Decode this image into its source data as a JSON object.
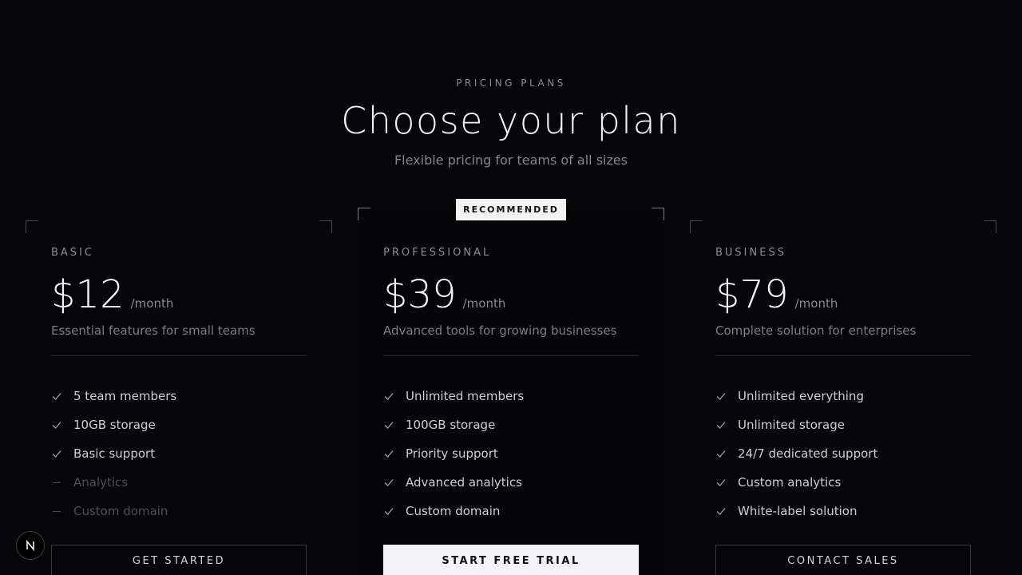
{
  "header": {
    "eyebrow": "PRICING PLANS",
    "title": "Choose your plan",
    "subtitle": "Flexible pricing for teams of all sizes"
  },
  "badge": {
    "label": "RECOMMENDED"
  },
  "plans": [
    {
      "name": "BASIC",
      "price": "$12",
      "period": "/month",
      "description": "Essential features for small teams",
      "features": [
        {
          "label": "5 team members",
          "included": true
        },
        {
          "label": "10GB storage",
          "included": true
        },
        {
          "label": "Basic support",
          "included": true
        },
        {
          "label": "Analytics",
          "included": false
        },
        {
          "label": "Custom domain",
          "included": false
        }
      ],
      "cta": "GET STARTED"
    },
    {
      "name": "PROFESSIONAL",
      "price": "$39",
      "period": "/month",
      "description": "Advanced tools for growing businesses",
      "features": [
        {
          "label": "Unlimited members",
          "included": true
        },
        {
          "label": "100GB storage",
          "included": true
        },
        {
          "label": "Priority support",
          "included": true
        },
        {
          "label": "Advanced analytics",
          "included": true
        },
        {
          "label": "Custom domain",
          "included": true
        }
      ],
      "cta": "START FREE TRIAL"
    },
    {
      "name": "BUSINESS",
      "price": "$79",
      "period": "/month",
      "description": "Complete solution for enterprises",
      "features": [
        {
          "label": "Unlimited everything",
          "included": true
        },
        {
          "label": "Unlimited storage",
          "included": true
        },
        {
          "label": "24/7 dedicated support",
          "included": true
        },
        {
          "label": "Custom analytics",
          "included": true
        },
        {
          "label": "White-label solution",
          "included": true
        }
      ],
      "cta": "CONTACT SALES"
    }
  ],
  "icons": {
    "check": "check-icon",
    "unavailable": "dash-icon",
    "logo": "n-logo-icon"
  },
  "colors": {
    "background": "#060608",
    "text": "#f2f2f4",
    "muted": "#85858b",
    "accent_button": "#f3f3f5"
  }
}
